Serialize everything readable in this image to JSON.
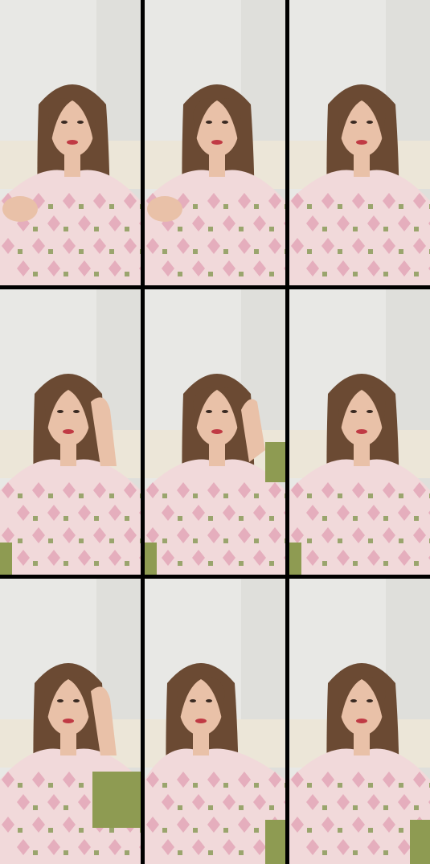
{
  "frames": [
    {
      "label": "",
      "pose": "hand-forward"
    },
    {
      "label": "",
      "pose": "hand-forward"
    },
    {
      "label": "",
      "pose": "neutral"
    },
    {
      "label": "",
      "pose": "hand-head"
    },
    {
      "label": "",
      "pose": "wave"
    },
    {
      "label": "",
      "pose": "neutral"
    },
    {
      "label": "",
      "pose": "hand-temple"
    },
    {
      "label": "",
      "pose": "tilt"
    },
    {
      "label": "",
      "pose": "neutral"
    }
  ],
  "colors": {
    "divider": "#000000",
    "wall": "#e8e8e5",
    "wall_shadow": "#d6d6d2",
    "sofa": "#ece6d8",
    "hair": "#6b4a33",
    "skin": "#e9c1a8",
    "shirt": "#f1d9da",
    "shirt_pattern": "#e2a3b5",
    "shirt_square": "#9aa56d",
    "sleeve_green": "#8e9b52",
    "lips": "#c03a44"
  }
}
